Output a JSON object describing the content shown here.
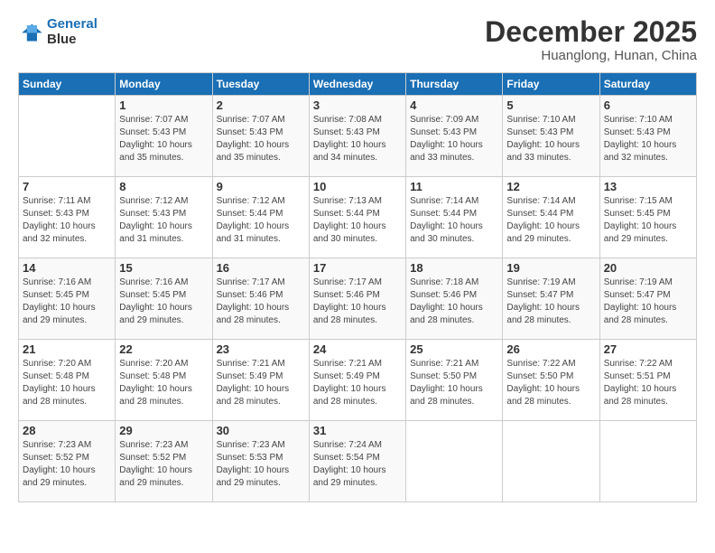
{
  "logo": {
    "line1": "General",
    "line2": "Blue"
  },
  "title": {
    "month": "December 2025",
    "location": "Huanglong, Hunan, China"
  },
  "headers": [
    "Sunday",
    "Monday",
    "Tuesday",
    "Wednesday",
    "Thursday",
    "Friday",
    "Saturday"
  ],
  "weeks": [
    [
      {
        "day": "",
        "info": ""
      },
      {
        "day": "1",
        "info": "Sunrise: 7:07 AM\nSunset: 5:43 PM\nDaylight: 10 hours\nand 35 minutes."
      },
      {
        "day": "2",
        "info": "Sunrise: 7:07 AM\nSunset: 5:43 PM\nDaylight: 10 hours\nand 35 minutes."
      },
      {
        "day": "3",
        "info": "Sunrise: 7:08 AM\nSunset: 5:43 PM\nDaylight: 10 hours\nand 34 minutes."
      },
      {
        "day": "4",
        "info": "Sunrise: 7:09 AM\nSunset: 5:43 PM\nDaylight: 10 hours\nand 33 minutes."
      },
      {
        "day": "5",
        "info": "Sunrise: 7:10 AM\nSunset: 5:43 PM\nDaylight: 10 hours\nand 33 minutes."
      },
      {
        "day": "6",
        "info": "Sunrise: 7:10 AM\nSunset: 5:43 PM\nDaylight: 10 hours\nand 32 minutes."
      }
    ],
    [
      {
        "day": "7",
        "info": "Sunrise: 7:11 AM\nSunset: 5:43 PM\nDaylight: 10 hours\nand 32 minutes."
      },
      {
        "day": "8",
        "info": "Sunrise: 7:12 AM\nSunset: 5:43 PM\nDaylight: 10 hours\nand 31 minutes."
      },
      {
        "day": "9",
        "info": "Sunrise: 7:12 AM\nSunset: 5:44 PM\nDaylight: 10 hours\nand 31 minutes."
      },
      {
        "day": "10",
        "info": "Sunrise: 7:13 AM\nSunset: 5:44 PM\nDaylight: 10 hours\nand 30 minutes."
      },
      {
        "day": "11",
        "info": "Sunrise: 7:14 AM\nSunset: 5:44 PM\nDaylight: 10 hours\nand 30 minutes."
      },
      {
        "day": "12",
        "info": "Sunrise: 7:14 AM\nSunset: 5:44 PM\nDaylight: 10 hours\nand 29 minutes."
      },
      {
        "day": "13",
        "info": "Sunrise: 7:15 AM\nSunset: 5:45 PM\nDaylight: 10 hours\nand 29 minutes."
      }
    ],
    [
      {
        "day": "14",
        "info": "Sunrise: 7:16 AM\nSunset: 5:45 PM\nDaylight: 10 hours\nand 29 minutes."
      },
      {
        "day": "15",
        "info": "Sunrise: 7:16 AM\nSunset: 5:45 PM\nDaylight: 10 hours\nand 29 minutes."
      },
      {
        "day": "16",
        "info": "Sunrise: 7:17 AM\nSunset: 5:46 PM\nDaylight: 10 hours\nand 28 minutes."
      },
      {
        "day": "17",
        "info": "Sunrise: 7:17 AM\nSunset: 5:46 PM\nDaylight: 10 hours\nand 28 minutes."
      },
      {
        "day": "18",
        "info": "Sunrise: 7:18 AM\nSunset: 5:46 PM\nDaylight: 10 hours\nand 28 minutes."
      },
      {
        "day": "19",
        "info": "Sunrise: 7:19 AM\nSunset: 5:47 PM\nDaylight: 10 hours\nand 28 minutes."
      },
      {
        "day": "20",
        "info": "Sunrise: 7:19 AM\nSunset: 5:47 PM\nDaylight: 10 hours\nand 28 minutes."
      }
    ],
    [
      {
        "day": "21",
        "info": "Sunrise: 7:20 AM\nSunset: 5:48 PM\nDaylight: 10 hours\nand 28 minutes."
      },
      {
        "day": "22",
        "info": "Sunrise: 7:20 AM\nSunset: 5:48 PM\nDaylight: 10 hours\nand 28 minutes."
      },
      {
        "day": "23",
        "info": "Sunrise: 7:21 AM\nSunset: 5:49 PM\nDaylight: 10 hours\nand 28 minutes."
      },
      {
        "day": "24",
        "info": "Sunrise: 7:21 AM\nSunset: 5:49 PM\nDaylight: 10 hours\nand 28 minutes."
      },
      {
        "day": "25",
        "info": "Sunrise: 7:21 AM\nSunset: 5:50 PM\nDaylight: 10 hours\nand 28 minutes."
      },
      {
        "day": "26",
        "info": "Sunrise: 7:22 AM\nSunset: 5:50 PM\nDaylight: 10 hours\nand 28 minutes."
      },
      {
        "day": "27",
        "info": "Sunrise: 7:22 AM\nSunset: 5:51 PM\nDaylight: 10 hours\nand 28 minutes."
      }
    ],
    [
      {
        "day": "28",
        "info": "Sunrise: 7:23 AM\nSunset: 5:52 PM\nDaylight: 10 hours\nand 29 minutes."
      },
      {
        "day": "29",
        "info": "Sunrise: 7:23 AM\nSunset: 5:52 PM\nDaylight: 10 hours\nand 29 minutes."
      },
      {
        "day": "30",
        "info": "Sunrise: 7:23 AM\nSunset: 5:53 PM\nDaylight: 10 hours\nand 29 minutes."
      },
      {
        "day": "31",
        "info": "Sunrise: 7:24 AM\nSunset: 5:54 PM\nDaylight: 10 hours\nand 29 minutes."
      },
      {
        "day": "",
        "info": ""
      },
      {
        "day": "",
        "info": ""
      },
      {
        "day": "",
        "info": ""
      }
    ]
  ]
}
